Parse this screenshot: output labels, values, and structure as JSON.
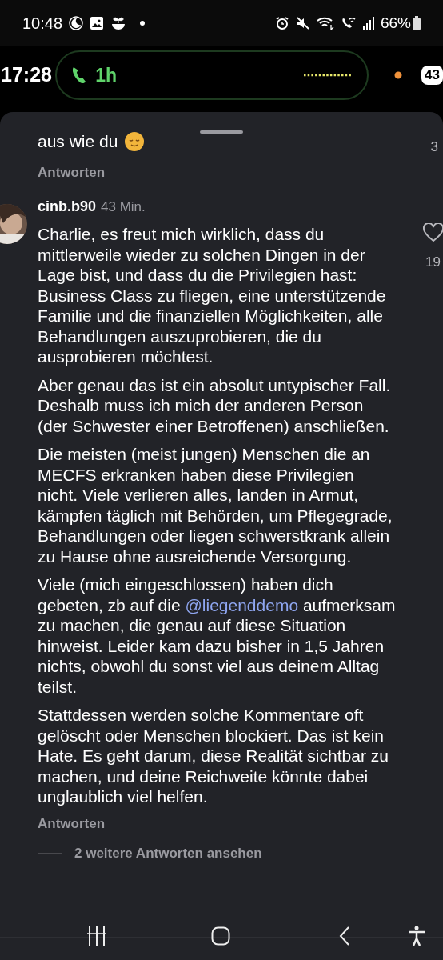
{
  "status_bar": {
    "time": "10:48",
    "battery": "66%"
  },
  "call_bar": {
    "clock": "17:28",
    "duration": "1h",
    "badge": "43"
  },
  "comments": [
    {
      "kind": "tail",
      "text": "aus wie du",
      "reply": "Antworten",
      "likes": "3"
    },
    {
      "kind": "full",
      "user": "cinb.b90",
      "time": "43 Min.",
      "likes": "19",
      "reply": "Antworten",
      "more_replies": "2 weitere Antworten ansehen",
      "paragraphs": [
        [
          {
            "kind": "text",
            "text": "Charlie, es freut mich wirklich, dass du mittlerweile wieder zu solchen Dingen in der Lage bist, und dass du die Privilegien hast: Business Class zu fliegen, eine unterstützende Familie und die finanziellen Möglichkeiten, alle Behandlungen auszuprobieren, die du ausprobieren möchtest."
          }
        ],
        [
          {
            "kind": "text",
            "text": "Aber genau das ist ein absolut untypischer Fall. Deshalb muss ich mich der anderen Person (der Schwester einer Betroffenen) anschließen."
          }
        ],
        [
          {
            "kind": "text",
            "text": "Die meisten (meist jungen) Menschen die an MECFS erkranken haben diese Privilegien nicht. Viele verlieren alles, landen in Armut, kämpfen täglich mit Behörden, um Pflegegrade, Behandlungen oder liegen schwerstkrank allein zu Hause ohne ausreichende Versorgung."
          }
        ],
        [
          {
            "kind": "text",
            "text": "Viele (mich eingeschlossen) haben dich gebeten, zb auf die "
          },
          {
            "kind": "mention",
            "text": "@liegenddemo"
          },
          {
            "kind": "text",
            "text": " aufmerksam zu machen, die genau auf diese Situation hinweist. Leider kam dazu bisher in 1,5 Jahren nichts, obwohl du sonst viel aus deinem Alltag teilst."
          }
        ],
        [
          {
            "kind": "text",
            "text": "Stattdessen werden solche Kommentare oft gelöscht oder Menschen blockiert. Das ist kein Hate. Es geht darum, diese Realität sichtbar zu machen, und deine Reichweite könnte dabei unglaublich viel helfen."
          }
        ]
      ]
    }
  ]
}
